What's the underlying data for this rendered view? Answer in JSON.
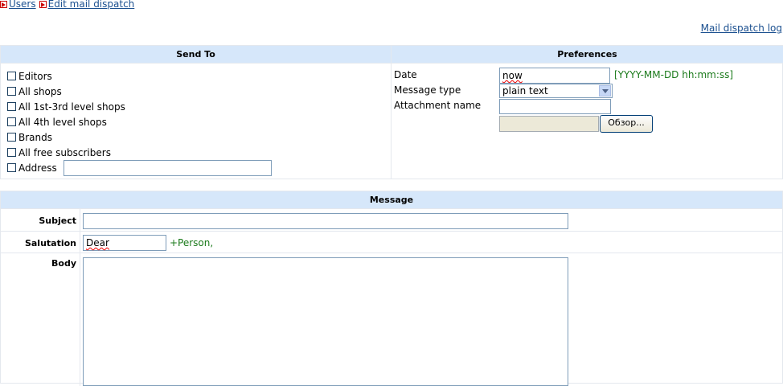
{
  "breadcrumb": {
    "items": [
      {
        "label": "Users",
        "icon": "arrow-box-icon"
      },
      {
        "label": "Edit mail dispatch",
        "icon": "arrow-box-icon"
      }
    ]
  },
  "log_link": "Mail dispatch log",
  "send_to": {
    "header": "Send To",
    "options": [
      {
        "label": "Editors",
        "checked": false
      },
      {
        "label": "All shops",
        "checked": false
      },
      {
        "label": "All 1st-3rd level shops",
        "checked": false
      },
      {
        "label": "All 4th level shops",
        "checked": false
      },
      {
        "label": "Brands",
        "checked": false
      },
      {
        "label": "All free subscribers",
        "checked": false
      },
      {
        "label": "Address",
        "checked": false
      }
    ],
    "address_value": ""
  },
  "preferences": {
    "header": "Preferences",
    "date_label": "Date",
    "date_value": "now",
    "date_hint": "[YYYY-MM-DD hh:mm:ss]",
    "message_type_label": "Message type",
    "message_type_value": "plain text",
    "attachment_label": "Attachment name",
    "attachment_value": "",
    "file_value": "",
    "browse_label": "Обзор..."
  },
  "message": {
    "header": "Message",
    "subject_label": "Subject",
    "subject_value": "",
    "salutation_label": "Salutation",
    "salutation_value": "Dear",
    "salutation_suffix": "+Person,",
    "body_label": "Body",
    "body_value": ""
  },
  "colors": {
    "header_bg": "#d6e7fa",
    "link": "#1a4f8f",
    "hint_green": "#1b7a1b",
    "input_border": "#7f9db9"
  }
}
